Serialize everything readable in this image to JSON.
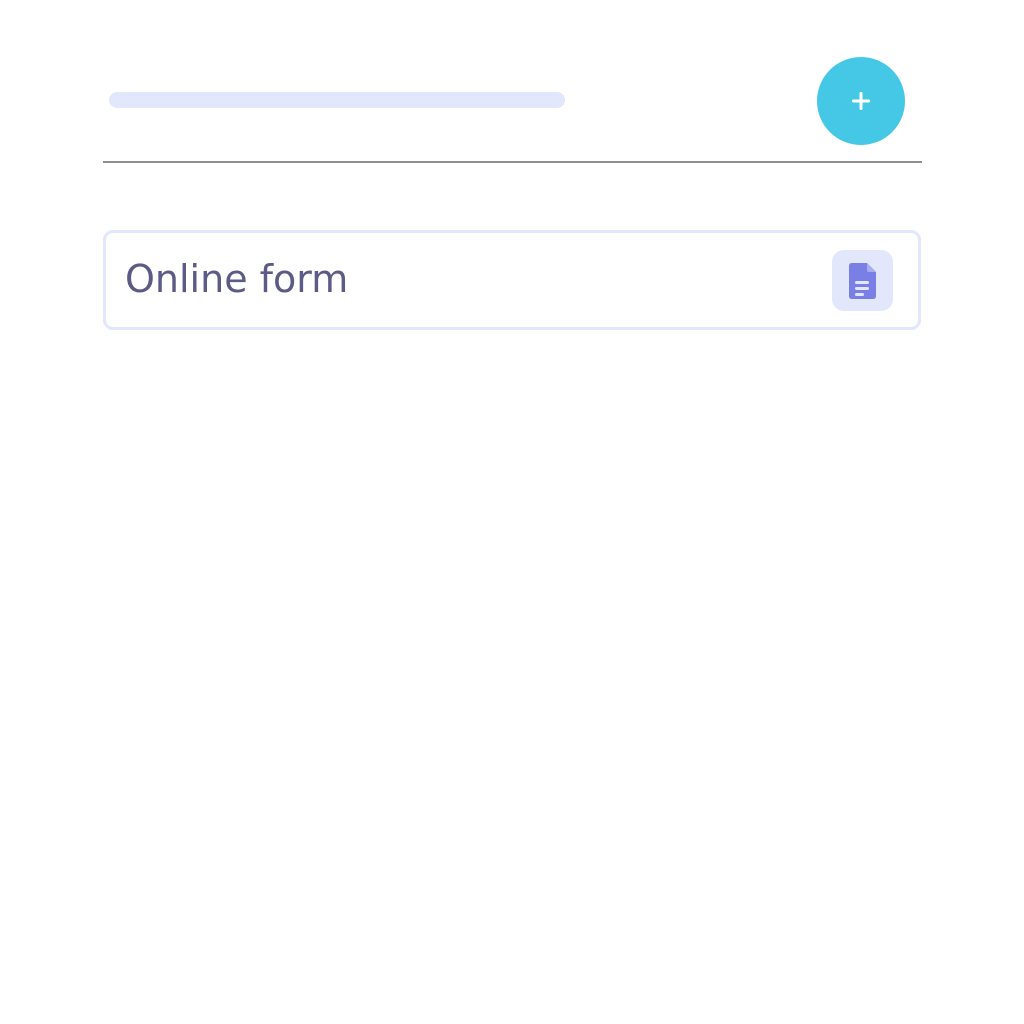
{
  "header": {
    "add_button_icon": "plus-icon"
  },
  "form_card": {
    "label": "Online form",
    "icon": "document-icon"
  },
  "colors": {
    "placeholder_bar": "#e3e7fb",
    "add_button": "#45c7e6",
    "divider": "#8f8f8f",
    "card_border": "#e3e7fb",
    "card_text": "#5c5a86",
    "icon_box": "#e3e7fb",
    "icon": "#7a7fe6"
  }
}
